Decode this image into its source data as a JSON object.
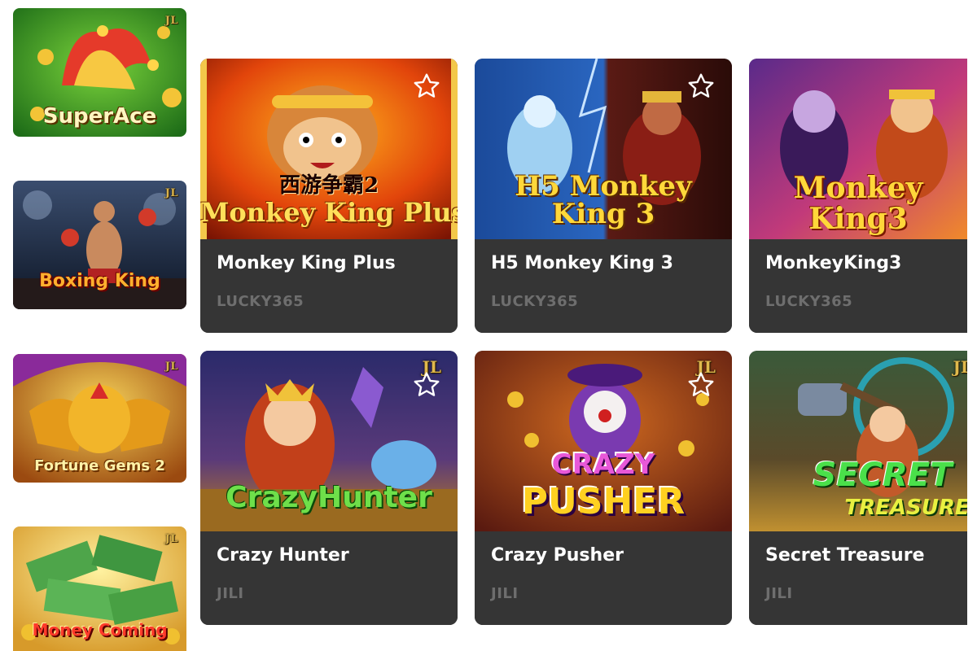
{
  "sidebar_games": [
    {
      "name": "SuperAce",
      "badge": "JL"
    },
    {
      "name": "Boxing King",
      "badge": "JL"
    },
    {
      "name": "Fortune Gems 2",
      "badge": "JL"
    },
    {
      "name": "Money Coming",
      "badge": "JL"
    }
  ],
  "games": [
    {
      "art_logo": "Monkey King Plus",
      "art_subtitle": "西游争霸2",
      "title": "Monkey King Plus",
      "provider": "LUCKY365"
    },
    {
      "art_logo": "H5 Monkey King 3",
      "title": "H5 Monkey King 3",
      "provider": "LUCKY365"
    },
    {
      "art_logo": "Monkey King3",
      "title": "MonkeyKing3",
      "provider": "LUCKY365"
    },
    {
      "art_logo": "CrazyHunter",
      "badge": "JL",
      "title": "Crazy Hunter",
      "provider": "JILI"
    },
    {
      "art_logo_1": "CRAZY",
      "art_logo_2": "PUSHER",
      "badge": "JL",
      "title": "Crazy Pusher",
      "provider": "JILI"
    },
    {
      "art_logo_1": "SECRET",
      "art_logo_2": "TREASURE",
      "badge": "JL",
      "title": "Secret Treasure",
      "provider": "JILI"
    }
  ],
  "colors": {
    "card_bg": "#353535",
    "title_text": "#ffffff",
    "provider_text": "#6e6e6e",
    "star_outline": "#ffffff",
    "jl_gold": "#e0b94c"
  },
  "icons": {
    "favorite": "star-outline-icon",
    "provider_badge": "jl-badge"
  }
}
